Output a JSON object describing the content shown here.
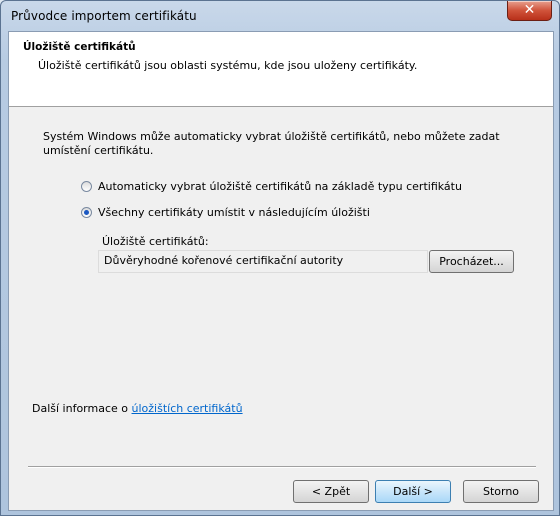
{
  "window": {
    "title": "Průvodce importem certifikátu",
    "close_glyph": "✕"
  },
  "header": {
    "title": "Úložiště certifikátů",
    "subtitle": "Úložiště certifikátů jsou oblasti systému, kde jsou uloženy certifikáty."
  },
  "body": {
    "intro": "Systém Windows může automaticky vybrat úložiště certifikátů, nebo můžete zadat umístění certifikátu.",
    "options": [
      {
        "label": "Automaticky vybrat úložiště certifikátů na základě typu certifikátu",
        "checked": false
      },
      {
        "label": "Všechny certifikáty umístit v následujícím úložišti",
        "checked": true
      }
    ],
    "store_label": "Úložiště certifikátů:",
    "store_value": "Důvěryhodné kořenové certifikační autority",
    "browse_label": "Procházet..."
  },
  "footer_info": {
    "prefix": "Další informace o ",
    "link": "úložištích certifikátů"
  },
  "buttons": {
    "back": "< Zpět",
    "next": "Další >",
    "cancel": "Storno"
  },
  "icons": {
    "close": "close-icon"
  },
  "colors": {
    "link": "#0066cc",
    "close_button": "#c8412a",
    "radio_dot": "#1b58c2"
  }
}
